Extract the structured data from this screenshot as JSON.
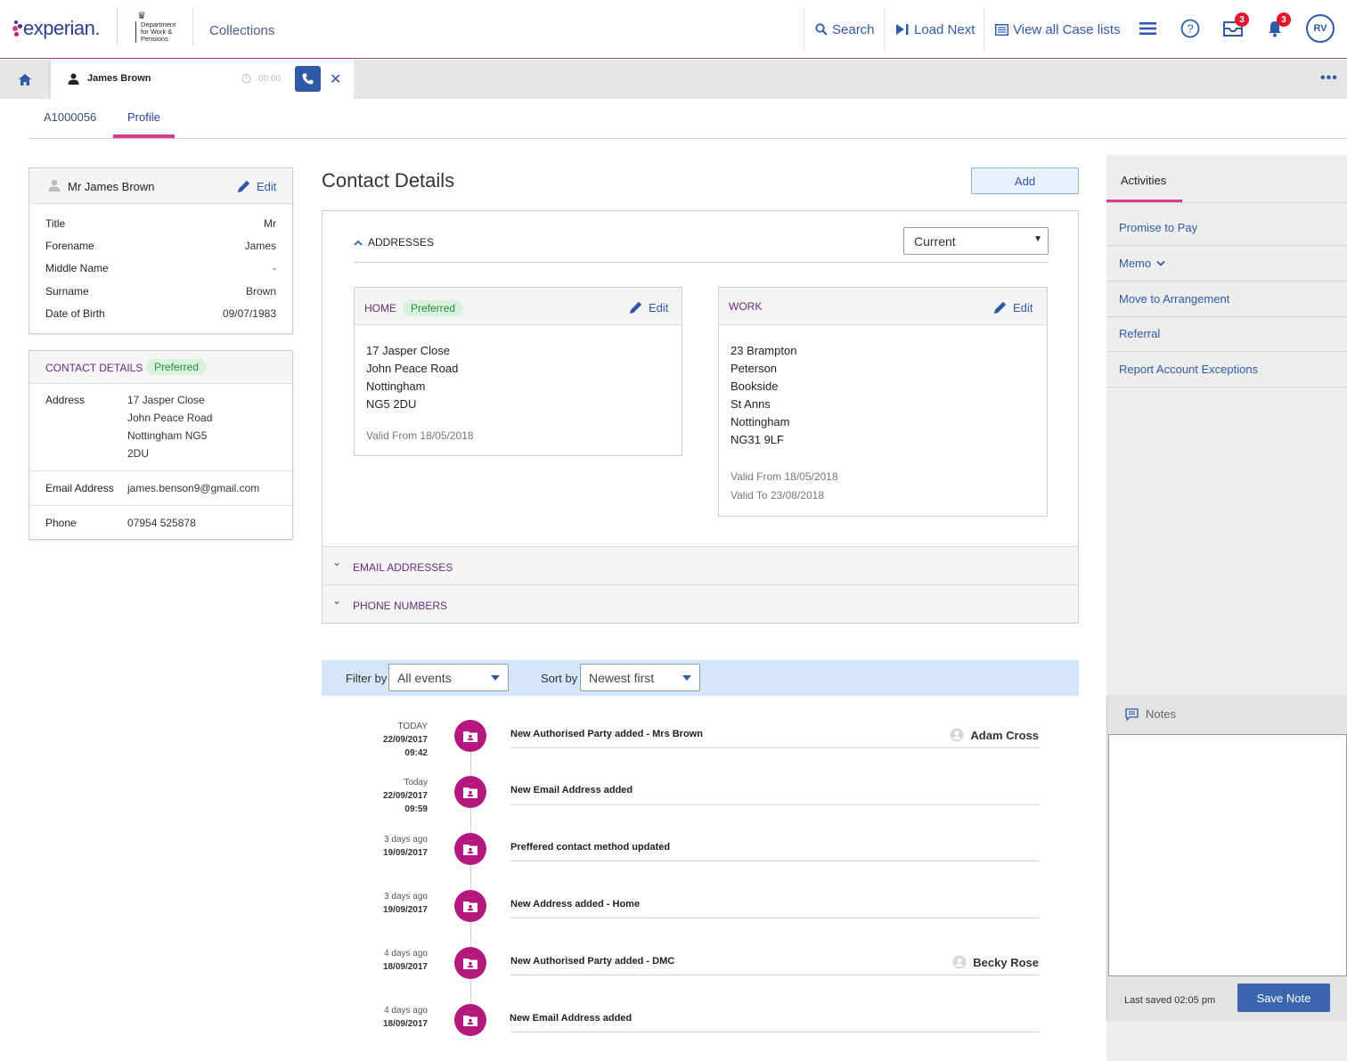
{
  "header": {
    "brand": "experian.",
    "dept": "Department for Work & Pensions",
    "app_title": "Collections",
    "search_label": "Search",
    "load_next_label": "Load Next",
    "case_lists_label": "View all Case lists",
    "inbox_count": "3",
    "notifications_count": "3",
    "user_initials": "RV"
  },
  "tabs": {
    "customer_name": "James Brown",
    "timer": "00:00"
  },
  "subtabs": {
    "account": "A1000056",
    "profile": "Profile"
  },
  "profile_panel": {
    "name": "Mr James Brown",
    "edit": "Edit",
    "fields": [
      {
        "label": "Title",
        "value": "Mr"
      },
      {
        "label": "Forename",
        "value": "James"
      },
      {
        "label": "Middle Name",
        "value": "-"
      },
      {
        "label": "Surname",
        "value": "Brown"
      },
      {
        "label": "Date of Birth",
        "value": "09/07/1983"
      }
    ]
  },
  "contact_panel": {
    "title": "CONTACT DETAILS",
    "badge": "Preferred",
    "address_label": "Address",
    "address_lines": [
      "17 Jasper Close",
      "John Peace Road",
      "Nottingham NG5",
      "2DU"
    ],
    "email_label": "Email Address",
    "email": "james.benson9@gmail.com",
    "phone_label": "Phone",
    "phone": "07954 525878"
  },
  "contact_details": {
    "title": "Contact Details",
    "add": "Add",
    "addresses_label": "ADDRESSES",
    "filter_value": "Current",
    "home": {
      "title": "HOME",
      "badge": "Preferred",
      "edit": "Edit",
      "lines": [
        "17 Jasper Close",
        "John Peace Road",
        "Nottingham",
        "NG5 2DU"
      ],
      "valid_from_label": "Valid From",
      "valid_from": "18/05/2018"
    },
    "work": {
      "title": "WORK",
      "edit": "Edit",
      "lines": [
        "23 Brampton",
        "Peterson",
        "Bookside",
        "St Anns",
        "Nottingham",
        "NG31 9LF"
      ],
      "valid_from_label": "Valid From",
      "valid_from": "18/05/2018",
      "valid_to_label": "Valid To",
      "valid_to": "23/08/2018"
    },
    "email_section": "EMAIL ADDRESSES",
    "phone_section": "PHONE NUMBERS"
  },
  "filters": {
    "filter_by_label": "Filter by",
    "filter_by_value": "All events",
    "sort_by_label": "Sort by",
    "sort_by_value": "Newest first"
  },
  "events": [
    {
      "relative": "TODAY",
      "date": "22/09/2017",
      "time": "09:42",
      "text": "New Authorised Party added - Mrs Brown",
      "user": "Adam Cross"
    },
    {
      "relative": "Today",
      "date": "22/09/2017",
      "time": "09:59",
      "text": "New Email Address added",
      "user": ""
    },
    {
      "relative": "3 days ago",
      "date": "19/09/2017",
      "time": "",
      "text": "Preffered contact method updated",
      "user": ""
    },
    {
      "relative": "3 days ago",
      "date": "19/09/2017",
      "time": "",
      "text": "New Address added - Home",
      "user": ""
    },
    {
      "relative": "4 days ago",
      "date": "18/09/2017",
      "time": "",
      "text": "New Authorised Party added - DMC",
      "user": "Becky Rose"
    },
    {
      "relative": "4 days ago",
      "date": "18/09/2017",
      "time": "",
      "text": "New Email Address added",
      "user": ""
    }
  ],
  "activities": {
    "tab": "Activities",
    "items": [
      "Promise to Pay",
      "Memo",
      "Move to Arrangement",
      "Referral",
      "Report Account Exceptions"
    ]
  },
  "notes": {
    "title": "Notes",
    "last_saved": "Last saved 02:05 pm",
    "save": "Save Note"
  },
  "colors": {
    "brand_blue": "#2f5aa8",
    "accent_pink": "#d63c8e",
    "event_magenta": "#b5177f",
    "preferred_green": "#2b8a43"
  }
}
